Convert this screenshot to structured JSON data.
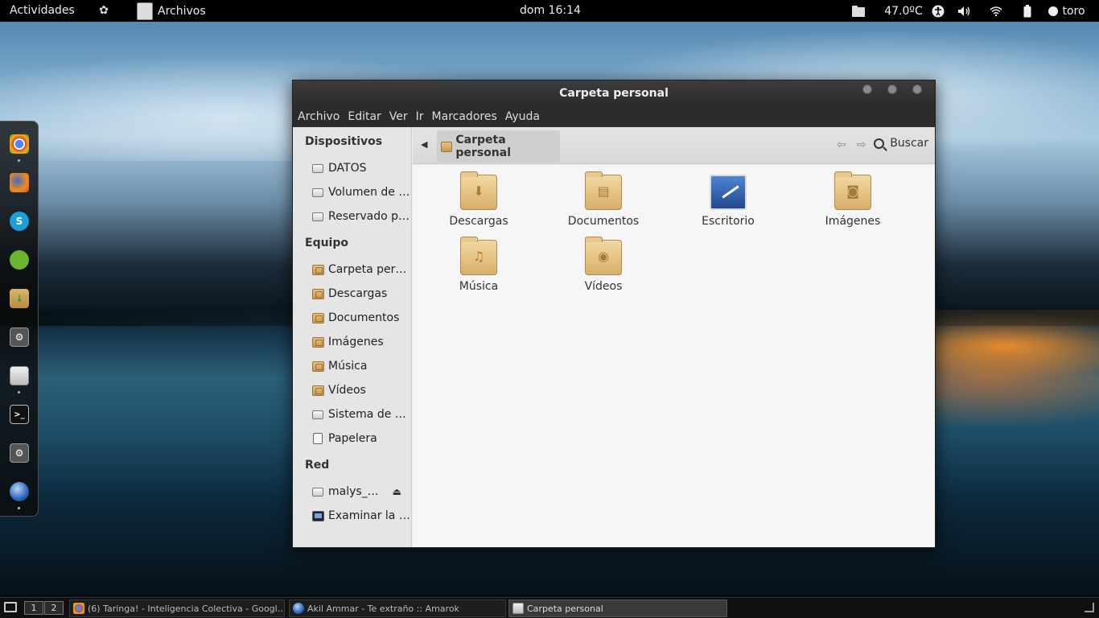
{
  "topbar": {
    "activities": "Actividades",
    "app_name": "Archivos",
    "clock": "dom 16:14",
    "temperature": "47.0ºC",
    "user": "toro"
  },
  "dock": {
    "items": [
      "chrome-icon",
      "firefox-icon",
      "skype-icon",
      "evernote-icon",
      "software-center-icon",
      "gear-icon",
      "files-icon",
      "terminal-icon",
      "gear-icon",
      "amarok-icon"
    ]
  },
  "window": {
    "title": "Carpeta personal",
    "menu": [
      "Archivo",
      "Editar",
      "Ver",
      "Ir",
      "Marcadores",
      "Ayuda"
    ],
    "sidebar": {
      "devices_heading": "Dispositivos",
      "devices": [
        "DATOS",
        "Volumen de …",
        "Reservado pa…"
      ],
      "computer_heading": "Equipo",
      "computer": [
        "Carpeta pers…",
        "Descargas",
        "Documentos",
        "Imágenes",
        "Música",
        "Vídeos",
        "Sistema de ar…",
        "Papelera"
      ],
      "network_heading": "Red",
      "network": [
        "malys_…",
        "Examinar la red"
      ]
    },
    "toolbar": {
      "path": "Carpeta personal",
      "search_label": "Buscar"
    },
    "files": [
      "Descargas",
      "Documentos",
      "Escritorio",
      "Imágenes",
      "Música",
      "Vídeos"
    ]
  },
  "taskbar": {
    "workspaces": [
      "1",
      "2"
    ],
    "tasks": [
      "(6) Taringa! - Inteligencia Colectiva - Googl…",
      "Akil Ammar - Te extraño  ::  Amarok",
      "Carpeta personal"
    ]
  }
}
